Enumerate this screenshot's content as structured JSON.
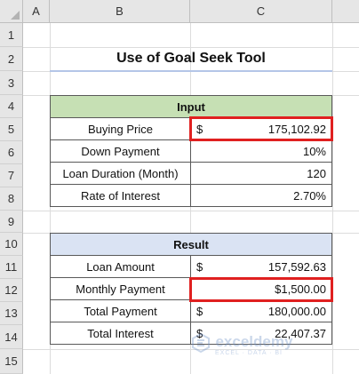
{
  "columns": [
    "A",
    "B",
    "C"
  ],
  "rows": [
    "1",
    "2",
    "3",
    "4",
    "5",
    "6",
    "7",
    "8",
    "9",
    "10",
    "11",
    "12",
    "13",
    "14",
    "15"
  ],
  "title": "Use of Goal Seek Tool",
  "input": {
    "header": "Input",
    "rows": [
      {
        "label": "Buying Price",
        "currency": "$",
        "value": "175,102.92"
      },
      {
        "label": "Down Payment",
        "currency": "",
        "value": "10%"
      },
      {
        "label": "Loan Duration (Month)",
        "currency": "",
        "value": "120"
      },
      {
        "label": "Rate of Interest",
        "currency": "",
        "value": "2.70%"
      }
    ]
  },
  "result": {
    "header": "Result",
    "rows": [
      {
        "label": "Loan Amount",
        "currency": "$",
        "value": "157,592.63"
      },
      {
        "label": "Monthly Payment",
        "currency": "",
        "value": "$1,500.00"
      },
      {
        "label": "Total Payment",
        "currency": "$",
        "value": "180,000.00"
      },
      {
        "label": "Total Interest",
        "currency": "$",
        "value": "22,407.37"
      }
    ]
  },
  "watermark": {
    "name": "exceldemy",
    "tagline": "EXCEL · DATA · BI"
  },
  "colors": {
    "input_header": "#c6e0b4",
    "result_header": "#dae3f3",
    "highlight": "#e02020"
  }
}
